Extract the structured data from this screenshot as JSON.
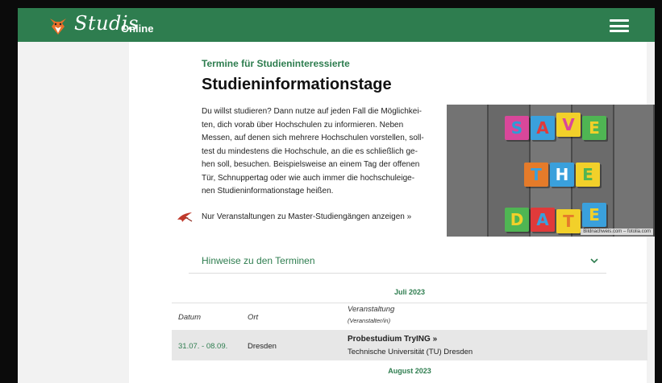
{
  "header": {
    "logo_text": "Studis",
    "logo_sub": "Online",
    "brand_color": "#2e7d4f",
    "logo_icon": "fox-icon",
    "menu_icon": "hamburger-menu-icon"
  },
  "main": {
    "kicker": "Termine für Studieninteressierte",
    "title": "Studieninformationstage",
    "intro_lines": [
      "Du willst studieren? Dann nutze auf jeden Fall die Möglichkei-",
      "ten, dich vorab über Hochschulen zu informieren. Neben",
      "Messen, auf denen sich mehrere Hochschulen vorstellen, soll-",
      "test du mindestens die Hochschule, an die es schließlich ge-",
      "hen soll, besuchen. Beispielsweise an einem Tag der offenen",
      "Tür, Schnuppertag oder wie auch immer die hochschuleige-",
      "nen Studieninformationstage heißen."
    ],
    "master_link": "Nur Veranstaltungen zu Master-Studiengängen anzeigen »",
    "master_link_icon": "bird-icon"
  },
  "photo": {
    "rows": [
      [
        "S",
        "A",
        "V",
        "E"
      ],
      [
        "T",
        "H",
        "E"
      ],
      [
        "D",
        "A",
        "T",
        "E"
      ]
    ],
    "credit": "Bildnachweis.com – fotolia.com"
  },
  "hinweise": {
    "label": "Hinweise zu den Terminen",
    "icon": "chevron-down-icon"
  },
  "table": {
    "months": [
      "Juli 2023",
      "August 2023"
    ],
    "headers": {
      "datum": "Datum",
      "ort": "Ort",
      "veranstaltung": "Veranstaltung",
      "veranstalter": "(Veranstalter/in)"
    },
    "rows": [
      {
        "datum": "31.07. - 08.09.",
        "ort": "Dresden",
        "title": "Probestudium TryING »",
        "org": "Technische Universität (TU) Dresden"
      }
    ]
  }
}
